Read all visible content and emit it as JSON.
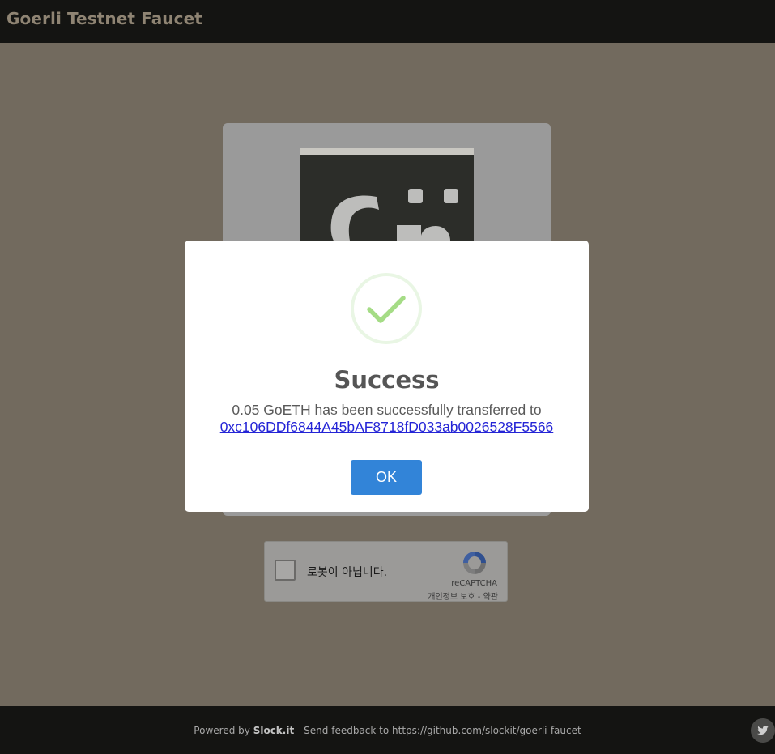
{
  "app": {
    "title": "Goerli Testnet Faucet"
  },
  "recaptcha": {
    "checkbox_label": "로봇이 아닙니다.",
    "brand": "reCAPTCHA",
    "links": "개인정보 보호 - 약관"
  },
  "modal": {
    "title": "Success",
    "message": "0.05 GoETH has been successfully transferred to",
    "address": "0xc106DDf6844A45bAF8718fD033ab0026528F5566",
    "ok_label": "OK"
  },
  "footer": {
    "powered_prefix": "Powered by",
    "brand": "Slock.it",
    "feedback": "- Send feedback to https://github.com/slockit/goerli-faucet"
  },
  "colors": {
    "accent": "#3284d8",
    "success": "#a5dc86",
    "topbar": "#141412",
    "backdrop": "#726a5e"
  },
  "icons": {
    "success": "checkmark-icon",
    "recaptcha": "recaptcha-logo-icon",
    "social": "twitter-icon"
  }
}
